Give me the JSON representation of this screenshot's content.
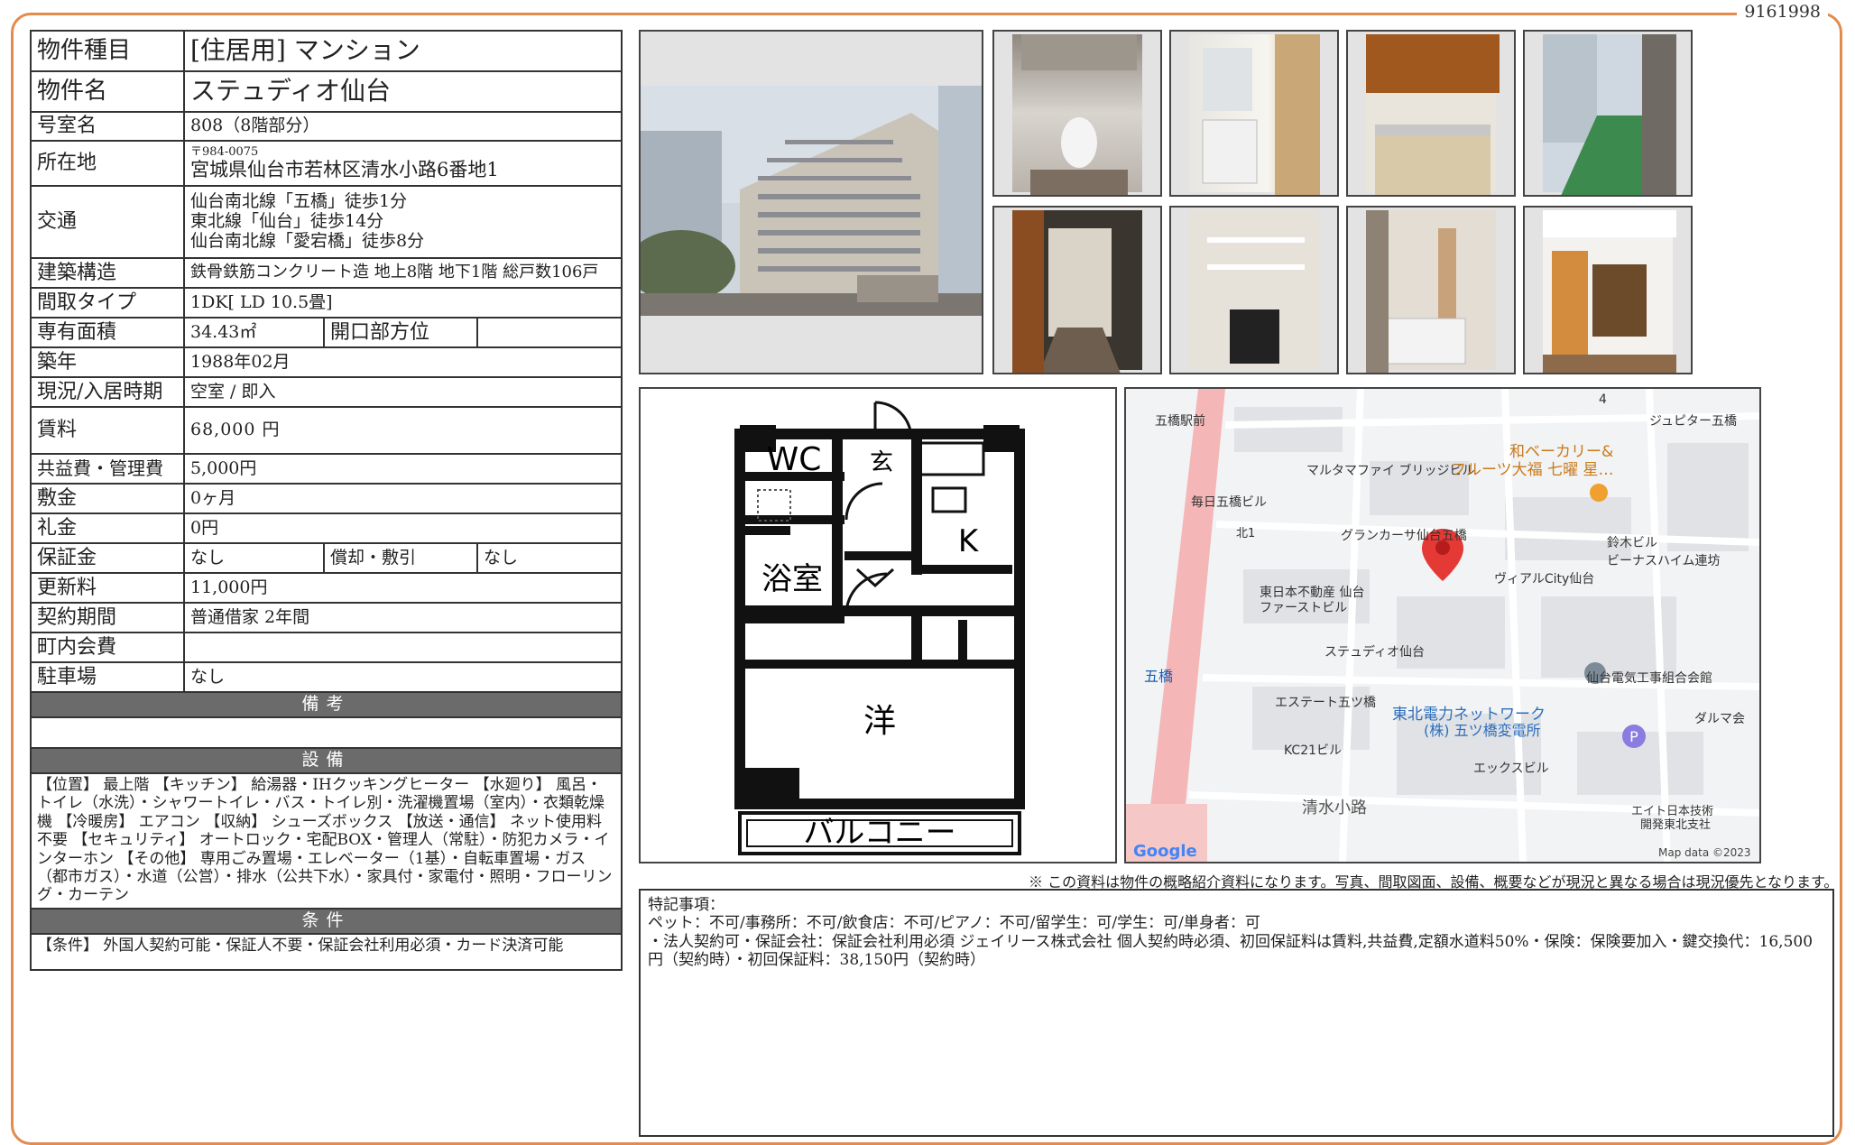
{
  "doc_id": "9161998",
  "property": {
    "type_label": "物件種目",
    "type_value": "[住居用] マンション",
    "name_label": "物件名",
    "name_value": "ステュディオ仙台",
    "room_label": "号室名",
    "room_value": "808（8階部分）",
    "address_label": "所在地",
    "postal": "〒984-0075",
    "address": "宮城県仙台市若林区清水小路6番地1",
    "transport_label": "交通",
    "transport": [
      "仙台南北線「五橋」徒歩1分",
      "東北線「仙台」徒歩14分",
      "仙台南北線「愛宕橋」徒歩8分"
    ],
    "structure_label": "建築構造",
    "structure_value": "鉄骨鉄筋コンクリート造 地上8階 地下1階 総戸数106戸",
    "layout_label": "間取タイプ",
    "layout_value": "1DK[ LD 10.5畳]",
    "area_label": "専有面積",
    "area_value": "34.43㎡",
    "direction_label": "開口部方位",
    "direction_value": "",
    "built_label": "築年",
    "built_value": "1988年02月",
    "status_label": "現況/入居時期",
    "status_value": "空室 / 即入",
    "rent_label": "賃料",
    "rent_value": "68,000 円",
    "fee_label": "共益費・管理費",
    "fee_value": "5,000円",
    "deposit_label": "敷金",
    "deposit_value": "0ヶ月",
    "key_money_label": "礼金",
    "key_money_value": "0円",
    "guarantee_label": "保証金",
    "guarantee_value": "なし",
    "amort_label": "償却・敷引",
    "amort_value": "なし",
    "renewal_label": "更新料",
    "renewal_value": "11,000円",
    "contract_label": "契約期間",
    "contract_value": "普通借家 2年間",
    "assoc_label": "町内会費",
    "assoc_value": "",
    "parking_label": "駐車場",
    "parking_value": "なし"
  },
  "sections": {
    "remarks_header": "備考",
    "remarks_text": "",
    "equipment_header": "設備",
    "equipment_text": "【位置】 最上階 【キッチン】 給湯器・IHクッキングヒーター 【水廻り】 風呂・トイレ（水洗）・シャワートイレ・バス・トイレ別・洗濯機置場（室内）・衣類乾燥機 【冷暖房】 エアコン 【収納】 シューズボックス 【放送・通信】 ネット使用料不要 【セキュリティ】 オートロック・宅配BOX・管理人（常駐）・防犯カメラ・インターホン 【その他】 専用ごみ置場・エレベーター（1基）・自転車置場・ガス（都市ガス）・水道（公営）・排水（公共下水）・家具付・家電付・照明・フローリング・カーテン",
    "conditions_header": "条件",
    "conditions_text": "【条件】 外国人契約可能・保証人不要・保証会社利用必須・カード決済可能"
  },
  "floorplan": {
    "wc": "WC",
    "genkan": "玄",
    "kitchen": "K",
    "bath": "浴室",
    "western": "洋",
    "balcony": "バルコニー"
  },
  "map": {
    "labels": [
      "五橋駅前",
      "4",
      "ジュピター五橋",
      "マルタマファイ ブリッジビル",
      "和ベーカリー&",
      "フルーツ大福 七曜 星…",
      "毎日五橋ビル",
      "北1",
      "グランカーサ仙台五橋",
      "鈴木ビル",
      "ビーナスハイム連坊",
      "ヴィアルCity仙台",
      "東日本不動産 仙台",
      "ファーストビル",
      "ステュディオ仙台",
      "五橋",
      "仙台電気工事組合会館",
      "エステート五ツ橋",
      "東北電力ネットワーク",
      "(株) 五ツ橋変電所",
      "ダルマ会",
      "KC21ビル",
      "エックスビル",
      "清水小路",
      "エイト日本技術",
      "開発東北支社",
      "Google",
      "Map data ©2023"
    ]
  },
  "disclaimer": "※ この資料は物件の概略紹介資料になります。写真、間取図面、設備、概要などが現況と異なる場合は現況優先となります。",
  "special_notes": {
    "title": "特記事項：",
    "line1": "ペット：不可/事務所：不可/飲食店：不可/ピアノ：不可/留学生：可/学生：可/単身者：可",
    "line2": "・法人契約可・保証会社：保証会社利用必須 ジェイリース株式会社 個人契約時必須、初回保証料は賃料,共益費,定額水道料50%・保険：保険要加入・鍵交換代：16,500円（契約時）・初回保証料：38,150円（契約時）"
  },
  "colors": {
    "frame": "#e38b4f",
    "section_header": "#6b6b6b",
    "map_road": "#f4b6b6",
    "map_pin": "#e53935"
  }
}
